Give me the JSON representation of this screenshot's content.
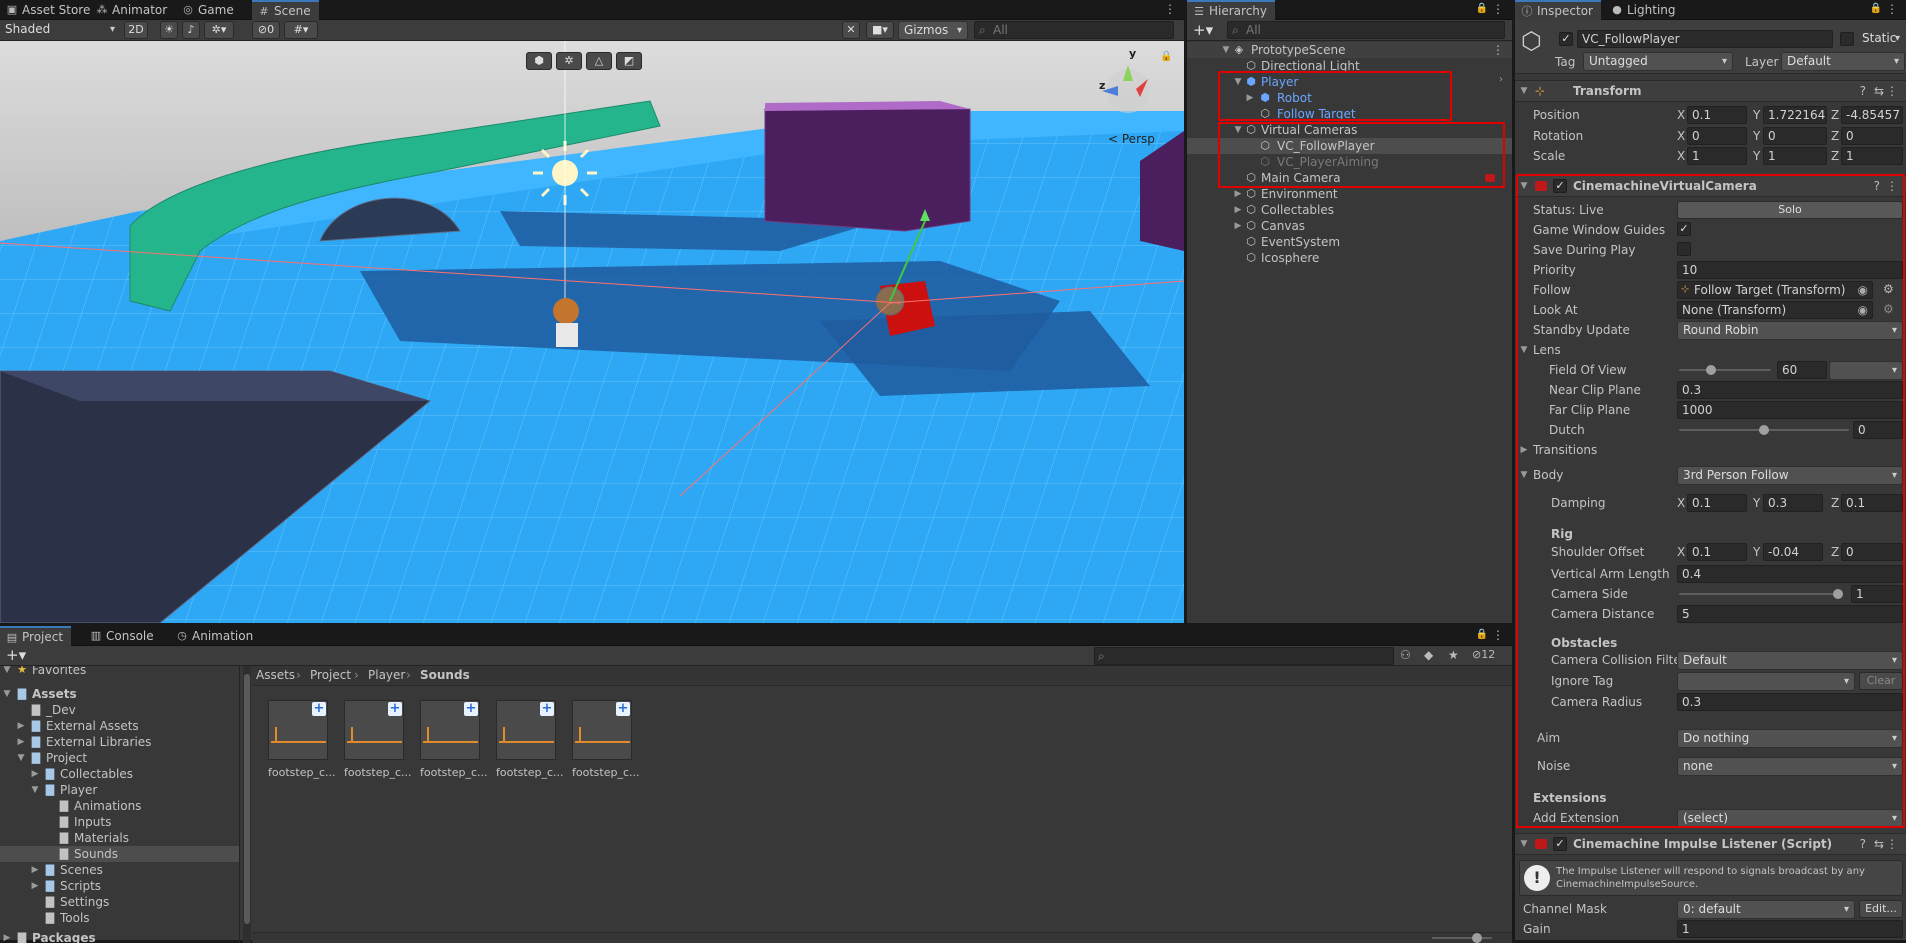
{
  "top_tabs": {
    "asset_store": "Asset Store",
    "animator": "Animator",
    "game": "Game",
    "scene": "Scene"
  },
  "scene_toolbar": {
    "shading_mode": "Shaded",
    "mode_2d": "2D",
    "hidden_count": "0",
    "gizmos": "Gizmos",
    "search_placeholder": "All",
    "persp_label": "Persp",
    "axis_y": "y",
    "axis_z": "z"
  },
  "hierarchy": {
    "tab": "Hierarchy",
    "search_placeholder": "All",
    "scene_name": "PrototypeScene",
    "items": [
      {
        "label": "Directional Light"
      },
      {
        "label": "Player"
      },
      {
        "label": "Robot"
      },
      {
        "label": "Follow Target"
      },
      {
        "label": "Virtual Cameras"
      },
      {
        "label": "VC_FollowPlayer"
      },
      {
        "label": "VC_PlayerAiming"
      },
      {
        "label": "Main Camera"
      },
      {
        "label": "Environment"
      },
      {
        "label": "Collectables"
      },
      {
        "label": "Canvas"
      },
      {
        "label": "EventSystem"
      },
      {
        "label": "Icosphere"
      }
    ]
  },
  "inspector": {
    "tab": "Inspector",
    "lighting_tab": "Lighting",
    "object_name": "VC_FollowPlayer",
    "static_label": "Static",
    "tag_label": "Tag",
    "tag_value": "Untagged",
    "layer_label": "Layer",
    "layer_value": "Default",
    "transform": {
      "title": "Transform",
      "position_label": "Position",
      "position": [
        "0.1",
        "1.722164",
        "-4.85457"
      ],
      "rotation_label": "Rotation",
      "rotation": [
        "0",
        "0",
        "0"
      ],
      "scale_label": "Scale",
      "scale": [
        "1",
        "1",
        "1"
      ]
    },
    "axes": [
      "X",
      "Y",
      "Z"
    ],
    "cvc": {
      "title": "CinemachineVirtualCamera",
      "status": "Status: Live",
      "solo": "Solo",
      "game_window_guides": "Game Window Guides",
      "save_during_play": "Save During Play",
      "priority_label": "Priority",
      "priority": "10",
      "follow_label": "Follow",
      "follow": "Follow Target (Transform)",
      "look_at_label": "Look At",
      "look_at": "None (Transform)",
      "standby_label": "Standby Update",
      "standby": "Round Robin",
      "lens": "Lens",
      "fov_label": "Field Of View",
      "fov": "60",
      "near_label": "Near Clip Plane",
      "near": "0.3",
      "far_label": "Far Clip Plane",
      "far": "1000",
      "dutch_label": "Dutch",
      "dutch": "0",
      "transitions": "Transitions",
      "body_label": "Body",
      "body": "3rd Person Follow",
      "damping_label": "Damping",
      "damping": [
        "0.1",
        "0.3",
        "0.1"
      ],
      "rig": "Rig",
      "shoulder_label": "Shoulder Offset",
      "shoulder": [
        "0.1",
        "-0.04",
        "0"
      ],
      "arm_label": "Vertical Arm Length",
      "arm": "0.4",
      "side_label": "Camera Side",
      "side": "1",
      "distance_label": "Camera Distance",
      "distance": "5",
      "obstacles": "Obstacles",
      "collision_label": "Camera Collision Filter",
      "collision": "Default",
      "ignore_label": "Ignore Tag",
      "clear": "Clear",
      "radius_label": "Camera Radius",
      "radius": "0.3",
      "aim_label": "Aim",
      "aim": "Do nothing",
      "noise_label": "Noise",
      "noise": "none",
      "extensions": "Extensions",
      "add_ext_label": "Add Extension",
      "add_ext": "(select)"
    },
    "impulse": {
      "title": "Cinemachine Impulse Listener (Script)",
      "info": "The Impulse Listener will respond to signals broadcast by any CinemachineImpulseSource.",
      "channel_label": "Channel Mask",
      "channel": "0: default",
      "edit": "Edit...",
      "gain_label": "Gain",
      "gain": "1"
    }
  },
  "project": {
    "tabs": [
      "Project",
      "Console",
      "Animation"
    ],
    "favorites": "Favorites",
    "tree": [
      {
        "label": "Assets"
      },
      {
        "label": "_Dev"
      },
      {
        "label": "External Assets"
      },
      {
        "label": "External Libraries"
      },
      {
        "label": "Project"
      },
      {
        "label": "Collectables"
      },
      {
        "label": "Player"
      },
      {
        "label": "Animations"
      },
      {
        "label": "Inputs"
      },
      {
        "label": "Materials"
      },
      {
        "label": "Sounds"
      },
      {
        "label": "Scenes"
      },
      {
        "label": "Scripts"
      },
      {
        "label": "Settings"
      },
      {
        "label": "Tools"
      },
      {
        "label": "Packages"
      }
    ],
    "breadcrumb": [
      "Assets",
      "Project",
      "Player",
      "Sounds"
    ],
    "hidden_count": "12",
    "files": [
      "footstep_c...",
      "footstep_c...",
      "footstep_c...",
      "footstep_c...",
      "footstep_c..."
    ]
  },
  "colors": {
    "accent": "#3a79bb",
    "highlight_box": "#e00000",
    "prefab_blue": "#6aa6ff"
  }
}
